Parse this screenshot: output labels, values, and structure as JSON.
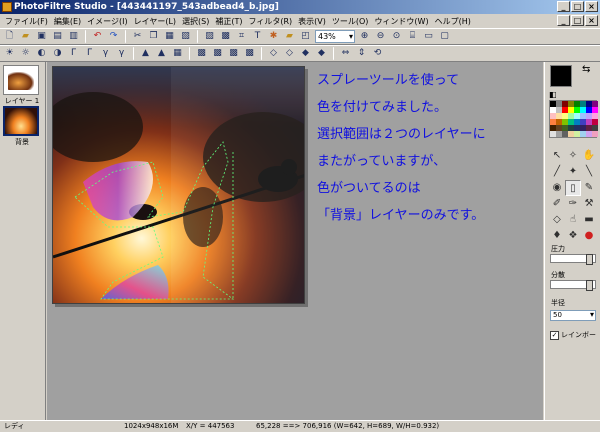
{
  "window": {
    "title": "PhotoFiltre Studio - [443441197_543adbead4_b.jpg]",
    "minimize": "_",
    "maximize": "□",
    "close": "×"
  },
  "menu": {
    "items": [
      "ファイル(F)",
      "編集(E)",
      "イメージ(I)",
      "レイヤー(L)",
      "選択(S)",
      "補正(T)",
      "フィルタ(R)",
      "表示(V)",
      "ツール(O)",
      "ウィンドウ(W)",
      "ヘルプ(H)"
    ]
  },
  "toolbar": {
    "zoom": "43%"
  },
  "layers": [
    {
      "label": "レイヤー 1"
    },
    {
      "label": "背景"
    }
  ],
  "annotation": {
    "lines": [
      "スプレーツールを使って",
      "色を付けてみました。",
      "選択範囲は２つのレイヤーに",
      "またがっていますが、",
      "色がついてるのは",
      "「背景」レイヤーのみです。"
    ],
    "color": "#1010e0"
  },
  "tools_panel": {
    "pressure_label": "圧力",
    "dispersion_label": "分散",
    "radius_label": "半径",
    "radius_value": "50",
    "rainbow_label": "レインボー",
    "rainbow_checked": "✓"
  },
  "status": {
    "state": "レディ",
    "size": "1024x948x16M",
    "xy": "X/Y = 447563",
    "selection": "65,228 ==> 706,916 (W=642, H=689, W/H=0.932)"
  }
}
